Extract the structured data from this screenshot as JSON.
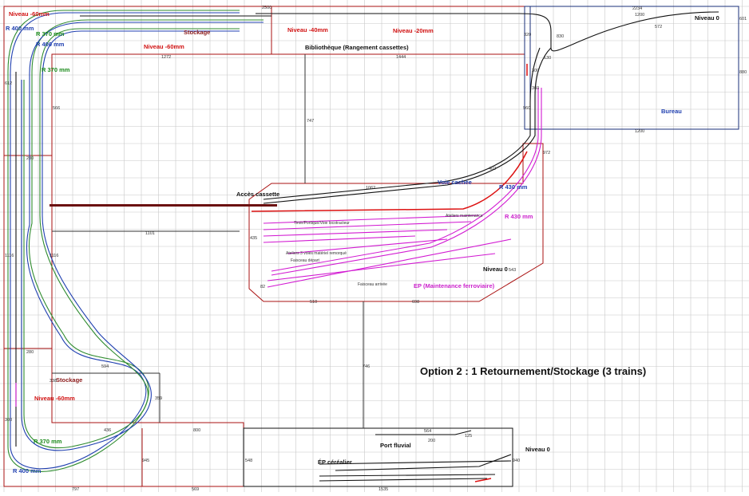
{
  "colors": {
    "grid": "#c8c8c8",
    "room": "#aa1111",
    "office": "#1a2f7a",
    "track_green": "#2e8b2e",
    "track_blue": "#1f3fb0",
    "track_black": "#111111",
    "track_magenta": "#d21ad2",
    "track_red": "#dd1111",
    "label_red": "#d11111",
    "label_green": "#1a8a1a",
    "label_blue": "#1f3fb0",
    "label_magenta": "#cc22cc",
    "dim": "#333333"
  },
  "title": "Option 2 : 1 Retournement/Stockage (3 trains)",
  "labels": {
    "niveau_m60_top": "Niveau -60mm",
    "niveau_m60_mid": "Niveau -60mm",
    "niveau_m60_left": "Niveau -60mm",
    "niveau_m40": "Niveau -40mm",
    "niveau_m20": "Niveau -20mm",
    "niveau_0_top": "Niveau 0",
    "niveau_0_mid": "Niveau 0",
    "niveau_0_bottom": "Niveau 0",
    "stockage_top": "Stockage",
    "stockage_left": "Stockage",
    "bibliotheque": "Bibliothèque (Rangement cassettes)",
    "bureau": "Bureau",
    "acces_cassette": "Accès cassette",
    "voie_cachee": "Voie cachée",
    "port_fluvial": "Port fluvial",
    "ep_cerealier": "ÉP céréalier",
    "ep_maintenance": "EP (Maintenance ferroviaire)",
    "r400_top": "R 400 mm",
    "r370_top": "R 370 mm",
    "r400_top2": "R 400 mm",
    "r370_left": "R 370 mm",
    "r370_bottom": "R 370 mm",
    "r400_bottom": "R 400 mm",
    "r430_a": "R 430 mm",
    "r430_b": "R 430 mm",
    "small_1": "Tiroir/Portique/Voie locotracteur",
    "small_2": "Ateliers maintenance",
    "small_3": "Ateliers 3 voies matériel remorqué",
    "small_4": "Faisceau départ",
    "small_5": "Faisceau arrivée"
  },
  "dims": {
    "d2500": "2500",
    "d1272": "1272",
    "d1444": "1444",
    "d2234": "2234",
    "d1200a": "1200",
    "d572": "572",
    "d601": "601",
    "d880": "880",
    "d830": "830",
    "d320": "320",
    "d130": "130",
    "d300": "300",
    "d360": "360",
    "d960": "960",
    "d972": "972",
    "d1200b": "1200",
    "d747": "747",
    "d402": "402",
    "d1062": "1062",
    "d1101": "1101",
    "d435": "435",
    "d510": "510",
    "d698": "698",
    "d543": "543",
    "d82": "82",
    "d612": "612",
    "d566": "566",
    "d1116a": "1116",
    "d1116b": "1116",
    "d280a": "280",
    "d280b": "280",
    "d594": "594",
    "d338": "338",
    "d359": "359",
    "d436": "436",
    "d800": "800",
    "d300b": "300",
    "d945": "945",
    "d746": "746",
    "d564": "564",
    "d125": "125",
    "d200": "200",
    "d940": "940",
    "d1535": "1535",
    "d797": "797",
    "d569": "569",
    "d548": "548"
  }
}
